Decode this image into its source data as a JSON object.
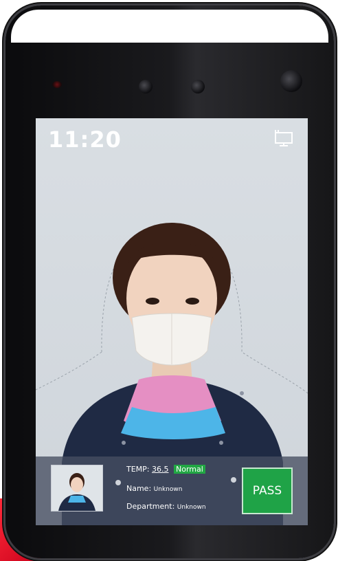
{
  "screen": {
    "time": "11:20",
    "status_icon": "monitor-icon"
  },
  "info": {
    "temp_label": "TEMP:",
    "temp_value": "36.5",
    "temp_status": "Normal",
    "name_label": "Name:",
    "name_value": "Unknown",
    "department_label": "Department:",
    "department_value": "Unknown",
    "result": "PASS"
  },
  "colors": {
    "pass_green": "#1fa347",
    "normal_green": "#22a744",
    "panel": "#464e62",
    "brand_red": "#e8102a"
  }
}
